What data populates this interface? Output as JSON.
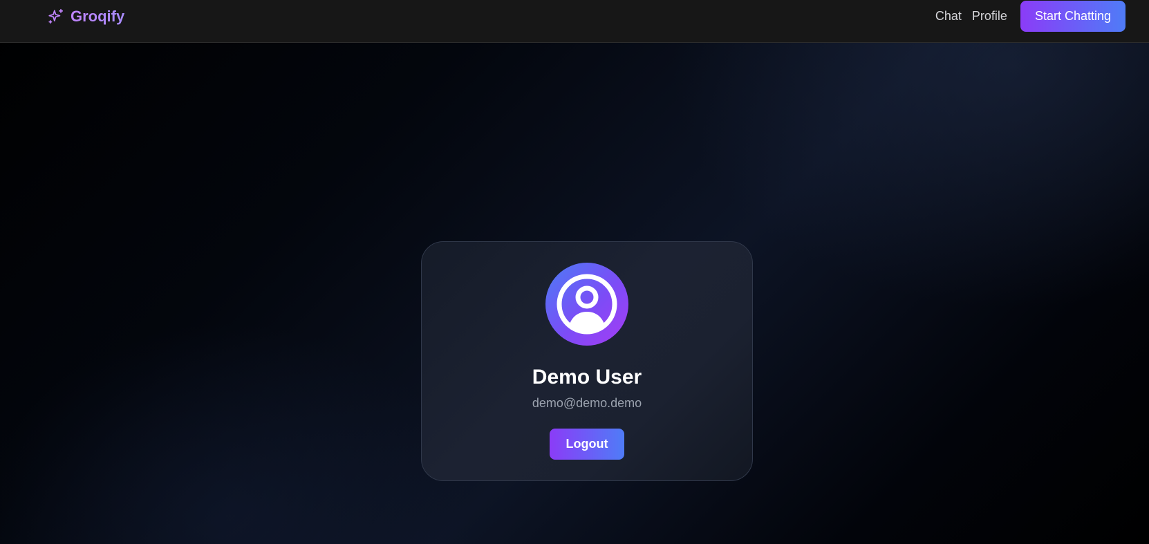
{
  "brand": {
    "name": "Groqify",
    "icon": "sparkles-icon"
  },
  "nav": {
    "items": [
      {
        "label": "Chat"
      },
      {
        "label": "Profile"
      }
    ],
    "cta_label": "Start Chatting"
  },
  "profile": {
    "avatar_icon": "user-circle-icon",
    "name": "Demo User",
    "email": "demo@demo.demo",
    "logout_label": "Logout"
  },
  "colors": {
    "accent_start": "#8b3cf7",
    "accent_end": "#4f7cf7",
    "brand_text": "#c084fc",
    "topbar_bg": "#171717",
    "card_bg": "#1c2232",
    "muted_text": "#9ca3af"
  }
}
